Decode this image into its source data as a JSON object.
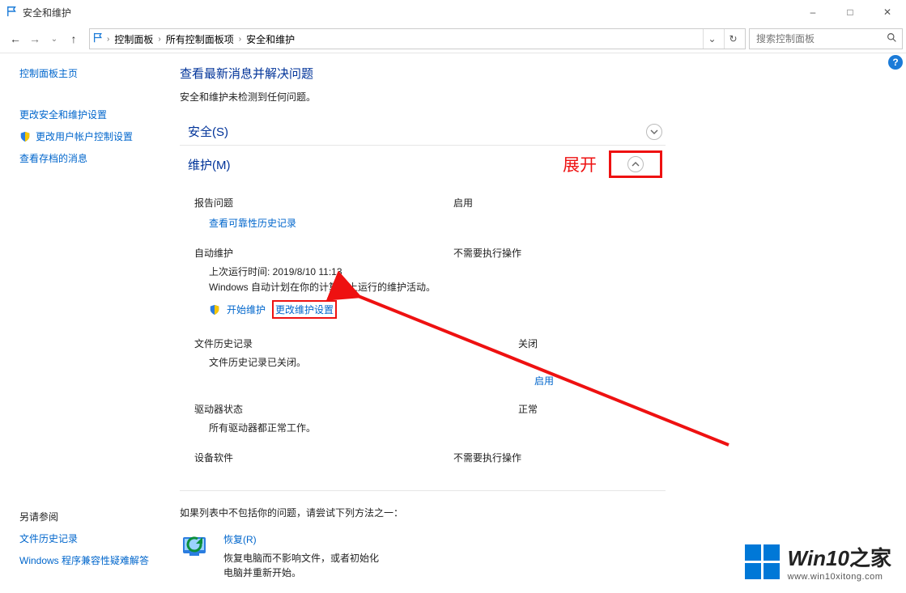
{
  "window": {
    "title": "安全和维护",
    "controls": {
      "minimize": "–",
      "maximize": "□",
      "close": "✕"
    },
    "help_tooltip": "?"
  },
  "nav": {
    "back": "←",
    "forward": "→",
    "up": "↑",
    "crumb1": "控制面板",
    "crumb2": "所有控制面板项",
    "crumb3": "安全和维护",
    "dropdown": "⌄",
    "refresh": "↻"
  },
  "search": {
    "placeholder": "搜索控制面板"
  },
  "sidebar": {
    "home": "控制面板主页",
    "link1": "更改安全和维护设置",
    "link2": "更改用户帐户控制设置",
    "link3": "查看存档的消息",
    "seealso_header": "另请参阅",
    "seealso1": "文件历史记录",
    "seealso2": "Windows 程序兼容性疑难解答"
  },
  "main": {
    "heading": "查看最新消息并解决问题",
    "subtext": "安全和维护未检测到任何问题。",
    "security_title": "安全(S)",
    "maintenance_title": "维护(M)",
    "annotation_expand": "展开",
    "report": {
      "label": "报告问题",
      "value": "启用",
      "link": "查看可靠性历史记录"
    },
    "automaint": {
      "label": "自动维护",
      "value": "不需要执行操作",
      "lastrun": "上次运行时间: 2019/8/10 11:13",
      "desc": "Windows 自动计划在你的计算机上运行的维护活动。",
      "start": "开始维护",
      "change": "更改维护设置"
    },
    "filehist": {
      "label": "文件历史记录",
      "value": "关闭",
      "desc": "文件历史记录已关闭。",
      "enable": "启用"
    },
    "drive": {
      "label": "驱动器状态",
      "value": "正常",
      "desc": "所有驱动器都正常工作。"
    },
    "devsoft": {
      "label": "设备软件",
      "value": "不需要执行操作"
    },
    "footer_note": "如果列表中不包括你的问题，请尝试下列方法之一：",
    "recovery": {
      "title": "恢复(R)",
      "desc": "恢复电脑而不影响文件，或者初始化电脑并重新开始。"
    }
  },
  "watermark": {
    "brand_en": "Win10",
    "brand_zh": "之家",
    "url": "www.win10xitong.com"
  }
}
